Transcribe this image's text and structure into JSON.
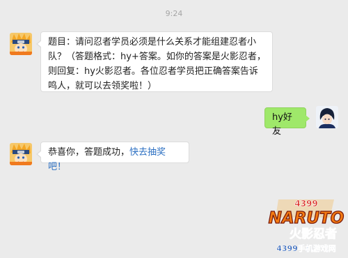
{
  "timestamp": "9:24",
  "messages": [
    {
      "sender": "bot",
      "avatar_icon": "naruto-avatar-icon",
      "text": "题目：请问忍者学员必须是什么关系才能组建忍者小队？（答题格式：hy+答案。如你的答案是火影忍者，则回复：hy火影忍者。各位忍者学员把正确答案告诉鸣人，就可以去领奖啦！）"
    },
    {
      "sender": "user",
      "avatar_icon": "user-avatar-icon",
      "text": "hy好友"
    },
    {
      "sender": "bot",
      "avatar_icon": "naruto-avatar-icon",
      "text": "恭喜你，答题成功，",
      "link": "快去抽奖吧！"
    }
  ],
  "watermark": {
    "top": "4399",
    "brand": "NARUTO",
    "subtitle": "火影忍者",
    "footer": "4399手机游戏网"
  },
  "colors": {
    "background": "#ebebeb",
    "user_bubble": "#9fe86a",
    "link": "#2b6fc2"
  }
}
